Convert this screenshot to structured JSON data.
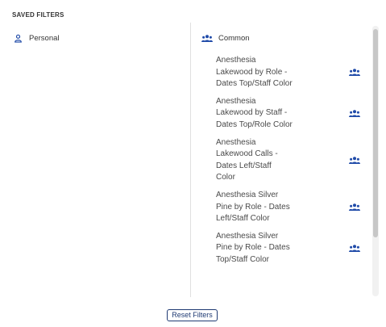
{
  "title": "SAVED FILTERS",
  "personal": {
    "label": "Personal",
    "icon": "person-icon"
  },
  "common": {
    "label": "Common",
    "icon": "group-icon",
    "items": [
      {
        "label": "Anesthesia Lakewood by Role - Dates Top/Staff Color",
        "icon": "group-icon"
      },
      {
        "label": "Anesthesia Lakewood by Staff - Dates Top/Role Color",
        "icon": "group-icon"
      },
      {
        "label": "Anesthesia Lakewood Calls - Dates Left/Staff Color",
        "icon": "group-icon"
      },
      {
        "label": "Anesthesia Silver Pine by Role - Dates Left/Staff Color",
        "icon": "group-icon"
      },
      {
        "label": "Anesthesia Silver Pine by Role - Dates Top/Staff Color",
        "icon": "group-icon"
      }
    ]
  },
  "reset_button": "Reset Filters",
  "colors": {
    "accent": "#1f3a73",
    "icon": "#1f4aa8"
  }
}
